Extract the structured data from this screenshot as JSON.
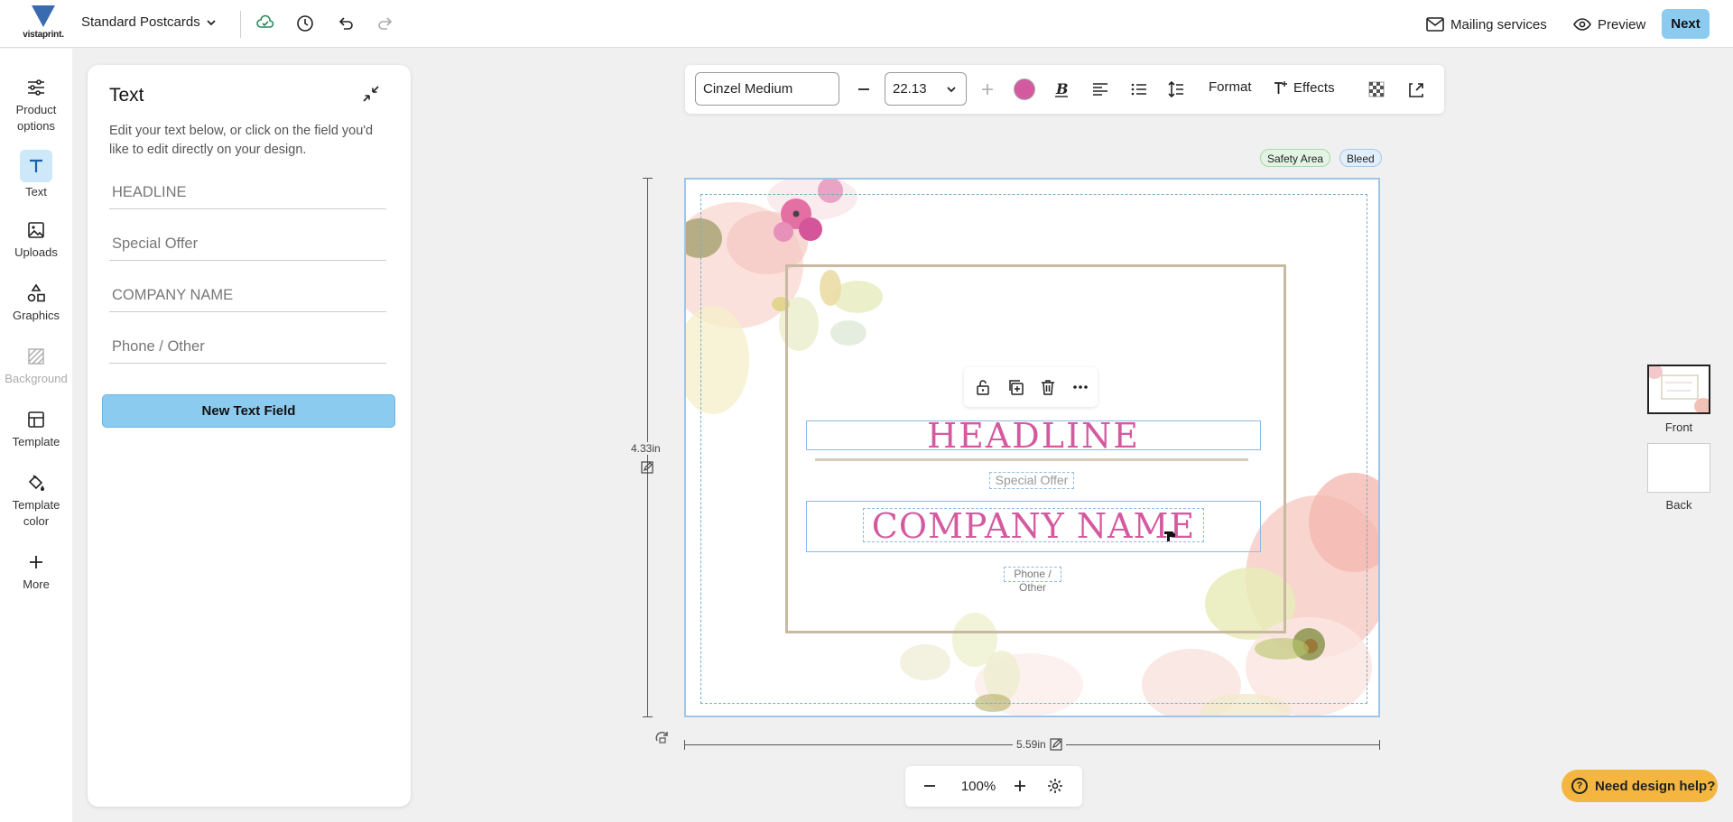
{
  "header": {
    "logo_text": "vistaprint.",
    "product_name": "Standard Postcards",
    "mailing_label": "Mailing services",
    "preview_label": "Preview",
    "next_label": "Next"
  },
  "rail": {
    "items": [
      {
        "label": "Product options",
        "icon": "sliders-icon"
      },
      {
        "label": "Text",
        "icon": "text-icon"
      },
      {
        "label": "Uploads",
        "icon": "image-icon"
      },
      {
        "label": "Graphics",
        "icon": "shapes-icon"
      },
      {
        "label": "Background",
        "icon": "background-icon"
      },
      {
        "label": "Template",
        "icon": "template-icon"
      },
      {
        "label": "Template color",
        "icon": "paint-bucket-icon"
      },
      {
        "label": "More",
        "icon": "plus-icon"
      }
    ]
  },
  "panel": {
    "title": "Text",
    "description": "Edit your text below, or click on the field you'd like to edit directly on your design.",
    "fields": [
      "HEADLINE",
      "Special Offer",
      "COMPANY NAME",
      "Phone / Other"
    ],
    "new_field_label": "New Text Field"
  },
  "toolbar": {
    "font_name": "Cinzel Medium",
    "font_size": "22.13",
    "text_color": "#d45aa0",
    "format_label": "Format",
    "effects_label": "Effects"
  },
  "canvas": {
    "safety_label": "Safety Area",
    "bleed_label": "Bleed",
    "height_label": "4.33in",
    "width_label": "5.59in",
    "headline": "HEADLINE",
    "special_offer": "Special Offer",
    "company_name": "COMPANY NAME",
    "phone": "Phone / Other"
  },
  "zoom": {
    "value": "100%"
  },
  "sides": {
    "front_label": "Front",
    "back_label": "Back"
  },
  "help": {
    "label": "Need design help?"
  },
  "colors": {
    "accent": "#8ccbf0",
    "help": "#f5b640",
    "brand_text": "#d45aa0"
  }
}
